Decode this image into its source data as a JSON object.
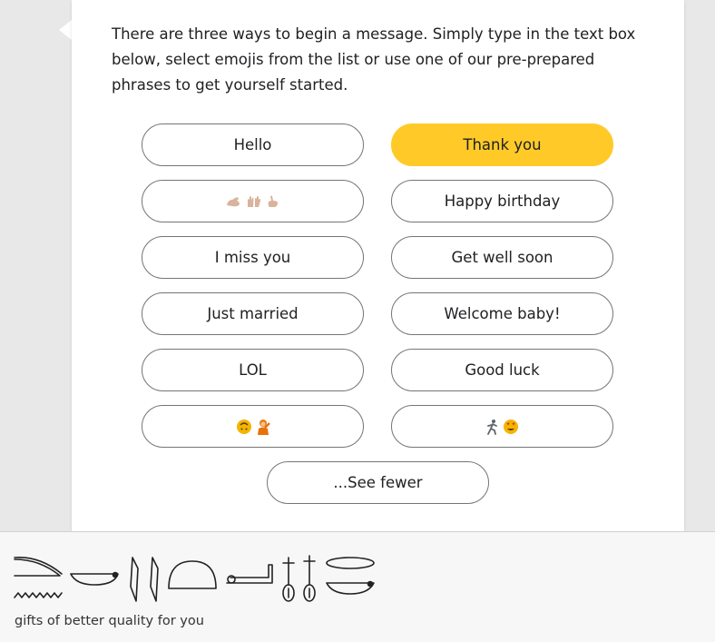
{
  "intro_text": "There are three ways to begin a message. Simply type in the text box below, select emojis from the list or use one of our pre-prepared phrases to get yourself started.",
  "phrases": [
    {
      "label": "Hello",
      "selected": false
    },
    {
      "label": "Thank you",
      "selected": true
    },
    {
      "label": "",
      "emoji": [
        "flexed-arm-icon",
        "raised-hands-icon",
        "pointing-hand-icon"
      ]
    },
    {
      "label": "Happy birthday",
      "selected": false
    },
    {
      "label": "I miss you",
      "selected": false
    },
    {
      "label": "Get well soon",
      "selected": false
    },
    {
      "label": "Just married",
      "selected": false
    },
    {
      "label": "Welcome baby!",
      "selected": false
    },
    {
      "label": "LOL",
      "selected": false
    },
    {
      "label": "Good luck",
      "selected": false
    },
    {
      "label": "",
      "emoji": [
        "upside-down-face-icon",
        "person-gesturing-icon"
      ]
    },
    {
      "label": "",
      "emoji": [
        "person-running-icon",
        "heart-eyes-face-icon"
      ]
    }
  ],
  "see_fewer_label": "...See fewer",
  "footer": {
    "tagline": "gifts of better quality for you",
    "hieroglyph_icon": "hieroglyph-translation-icon"
  },
  "colors": {
    "selected_pill": "#ffca28",
    "pill_border": "#757575",
    "card": "#ffffff",
    "page_bg": "#e8e8e8",
    "footer_bg": "#f7f7f7"
  }
}
